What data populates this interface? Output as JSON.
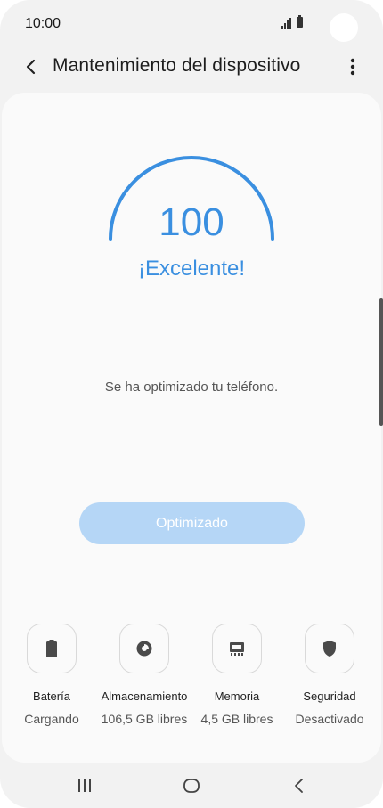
{
  "status_bar": {
    "time": "10:00",
    "icons": [
      "signal-icon",
      "battery-icon"
    ]
  },
  "header": {
    "title": "Mantenimiento del dispositivo",
    "back_icon": "chevron-left-icon",
    "more_icon": "more-vertical-icon"
  },
  "score": {
    "value": "100",
    "rating": "¡Excelente!",
    "color": "#3a8fe0"
  },
  "message": "Se ha optimizado tu teléfono.",
  "action_button": {
    "label": "Optimizado",
    "color": "#b5d6f6"
  },
  "tiles": [
    {
      "label": "Batería",
      "value": "Cargando",
      "icon": "battery-icon"
    },
    {
      "label": "Almacenamiento",
      "value": "106,5 GB libres",
      "icon": "storage-icon"
    },
    {
      "label": "Memoria",
      "value": "4,5 GB libres",
      "icon": "memory-icon"
    },
    {
      "label": "Seguridad",
      "value": "Desactivado",
      "icon": "shield-icon"
    }
  ],
  "nav_bar": {
    "buttons": [
      "recent-apps-icon",
      "home-icon",
      "back-icon"
    ]
  }
}
